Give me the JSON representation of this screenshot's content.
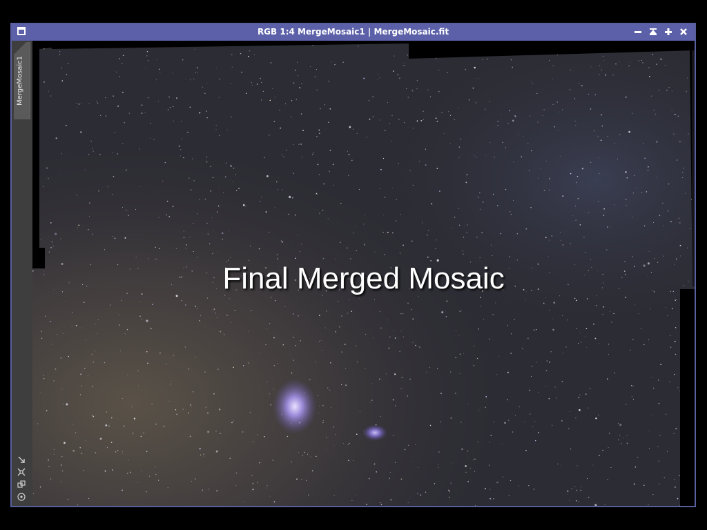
{
  "window": {
    "title": "RGB 1:4 MergeMosaic1 | MergeMosaic.fit",
    "buttons": [
      "minimize-button",
      "shade-button",
      "maximize-button",
      "close-button"
    ]
  },
  "sidebar": {
    "tab_label": "MergeMosaic1",
    "icons": [
      "fit-view-icon",
      "zoom-to-fit-icon",
      "clone-icon",
      "circle-target-icon"
    ]
  },
  "image": {
    "caption": "Final Merged Mosaic"
  },
  "colors": {
    "titlebar": "#5b60a8",
    "window_border": "#5a5fa0",
    "sky": "#2c2c34",
    "nebula": "#9a8ad8"
  }
}
